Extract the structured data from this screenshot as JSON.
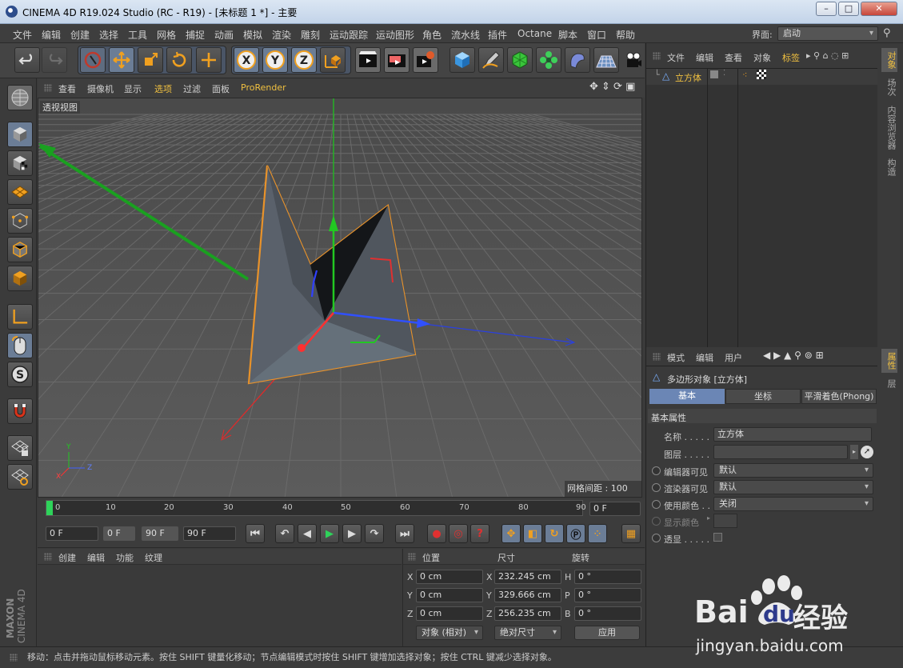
{
  "window": {
    "title": "CINEMA 4D R19.024 Studio (RC - R19) - [未标题 1 *] - 主要",
    "minimize": "–",
    "maximize": "□",
    "close": "✕"
  },
  "menu": [
    "文件",
    "编辑",
    "创建",
    "选择",
    "工具",
    "网格",
    "捕捉",
    "动画",
    "模拟",
    "渲染",
    "雕刻",
    "运动跟踪",
    "运动图形",
    "角色",
    "流水线",
    "插件",
    "Octane",
    "脚本",
    "窗口",
    "帮助"
  ],
  "layout": {
    "label": "界面:",
    "value": "启动"
  },
  "viewport": {
    "menu": [
      "查看",
      "摄像机",
      "显示",
      "选项",
      "过滤",
      "面板",
      "ProRender"
    ],
    "view_name": "透视视图",
    "grid_info": "网格间距 : 100 cm",
    "axis": {
      "x": "X",
      "y": "Y",
      "z": "Z"
    }
  },
  "timeline": {
    "ticks": [
      "0",
      "10",
      "20",
      "30",
      "40",
      "50",
      "60",
      "70",
      "80",
      "90"
    ],
    "current": "0 F"
  },
  "playback": {
    "start": "0 F",
    "range_start": "0 F",
    "range_end": "90 F",
    "end": "90 F"
  },
  "material": {
    "menu": [
      "创建",
      "编辑",
      "功能",
      "纹理"
    ],
    "logo_top": "MAXON",
    "logo_bottom": "CINEMA 4D"
  },
  "coords": {
    "headers": {
      "pos": "位置",
      "size": "尺寸",
      "rot": "旋转"
    },
    "rows": [
      {
        "a": "X",
        "pos": "0 cm",
        "b": "X",
        "size": "232.245 cm",
        "c": "H",
        "rot": "0 °"
      },
      {
        "a": "Y",
        "pos": "0 cm",
        "b": "Y",
        "size": "329.666 cm",
        "c": "P",
        "rot": "0 °"
      },
      {
        "a": "Z",
        "pos": "0 cm",
        "b": "Z",
        "size": "256.235 cm",
        "c": "B",
        "rot": "0 °"
      }
    ],
    "mode1": "对象 (相对)",
    "mode2": "绝对尺寸",
    "apply": "应用"
  },
  "objects": {
    "menu": [
      "文件",
      "编辑",
      "查看",
      "对象",
      "标签"
    ],
    "item": "立方体"
  },
  "attributes": {
    "menu": [
      "模式",
      "编辑",
      "用户"
    ],
    "title": "多边形对象 [立方体]",
    "tabs": [
      "基本",
      "坐标",
      "平滑着色(Phong)"
    ],
    "section": "基本属性",
    "name_label": "名称 . . . . .",
    "name_value": "立方体",
    "layer_label": "图层 . . . . .",
    "editor_vis_label": "编辑器可见",
    "editor_vis_value": "默认",
    "render_vis_label": "渲染器可见",
    "render_vis_value": "默认",
    "use_color_label": "使用颜色 . .",
    "use_color_value": "关闭",
    "display_color_label": "显示颜色",
    "xray_label": "透显 . . . . ."
  },
  "right_tabs": [
    "对象",
    "场次",
    "内容浏览器",
    "构造"
  ],
  "right_tabs2": [
    "属性",
    "层"
  ],
  "status": "移动：点击并拖动鼠标移动元素。按住 SHIFT 键量化移动；节点编辑模式时按住 SHIFT 键增加选择对象；按住 CTRL 键减少选择对象。",
  "watermark": {
    "brand": "Bai",
    "brand2": "du",
    "cn": "经验",
    "url": "jingyan.baidu.com"
  }
}
